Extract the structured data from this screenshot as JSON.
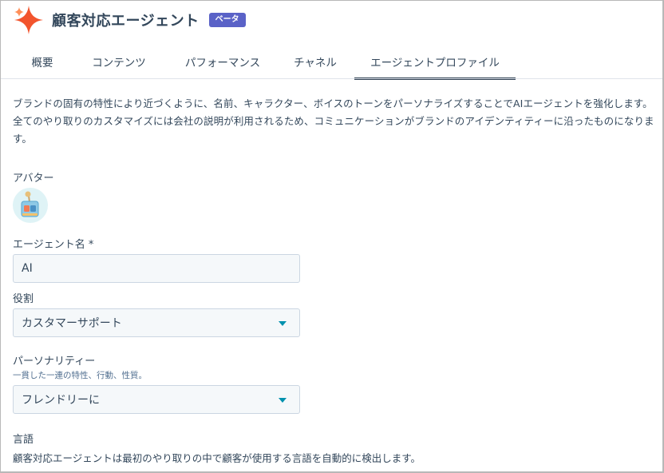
{
  "header": {
    "title": "顧客対応エージェント",
    "badge": "ベータ",
    "logo_icon": "sparkle-icon",
    "accent_color": "#f2542d"
  },
  "tabs": [
    {
      "label": "概要",
      "active": false
    },
    {
      "label": "コンテンツ",
      "active": false
    },
    {
      "label": "パフォーマンス",
      "active": false
    },
    {
      "label": "チャネル",
      "active": false
    },
    {
      "label": "エージェントプロファイル",
      "active": true
    }
  ],
  "description": {
    "line1": "ブランドの固有の特性により近づくように、名前、キャラクター、ボイスのトーンをパーソナライズすることでAIエージェントを強化します。",
    "line2": "全てのやり取りのカスタマイズには会社の説明が利用されるため、コミュニケーションがブランドのアイデンティティーに沿ったものになりま",
    "line3": "す。"
  },
  "avatar": {
    "label": "アバター",
    "icon": "robot-avatar-icon"
  },
  "agent_name": {
    "label": "エージェント名 *",
    "value": "AI"
  },
  "role": {
    "label": "役割",
    "value": "カスタマーサポート"
  },
  "personality": {
    "label": "パーソナリティー",
    "hint": "一貫した一連の特性、行動、性質。",
    "value": "フレンドリーに"
  },
  "language": {
    "label": "言語",
    "text": "顧客対応エージェントは最初のやり取りの中で顧客が使用する言語を自動的に検出します。"
  }
}
